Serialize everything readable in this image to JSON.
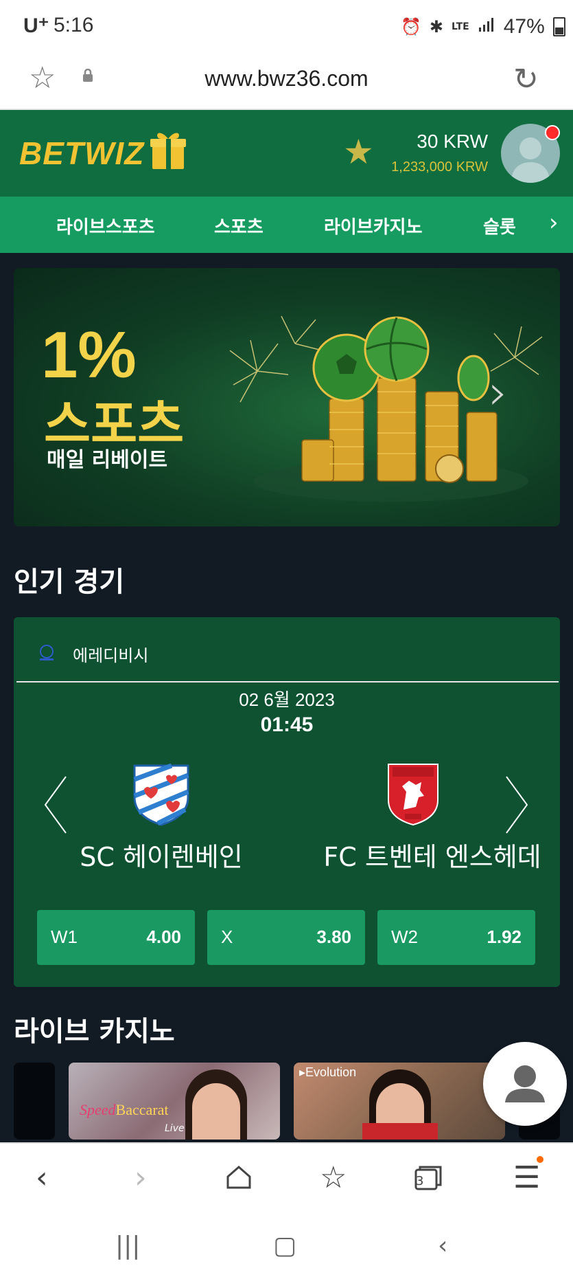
{
  "status_bar": {
    "carrier": "U⁺",
    "time": "5:16",
    "network": "LTE",
    "battery": "47%"
  },
  "browser": {
    "url": "www.bwz36.com",
    "tab_count": "3"
  },
  "site": {
    "logo": "BETWIZ",
    "balance": "30 KRW",
    "bonus_balance": "1,233,000 KRW"
  },
  "nav": {
    "items": [
      "라이브스포츠",
      "스포츠",
      "라이브카지노",
      "슬롯"
    ]
  },
  "banner": {
    "percent": "1%",
    "title": "스포츠",
    "subtitle": "매일 리베이트"
  },
  "popular": {
    "section_title": "인기 경기",
    "league": "에레디비시",
    "date": "02 6월 2023",
    "time": "01:45",
    "home_team": "SC 헤이렌베인",
    "away_team": "FC 트벤테 엔스헤데",
    "odds": [
      {
        "label": "W1",
        "value": "4.00"
      },
      {
        "label": "X",
        "value": "3.80"
      },
      {
        "label": "W2",
        "value": "1.92"
      }
    ]
  },
  "live_casino": {
    "section_title": "라이브 카지노",
    "games": [
      {
        "name_prefix": "Speed",
        "name_main": "Baccarat",
        "tag": "Live"
      },
      {
        "provider": "Evolution"
      }
    ]
  },
  "colors": {
    "header_green": "#106d3f",
    "nav_green": "#169c61",
    "card_green": "#0e5232",
    "odds_green": "#1a9a62",
    "gold": "#f3d34a",
    "background": "#121a24"
  }
}
